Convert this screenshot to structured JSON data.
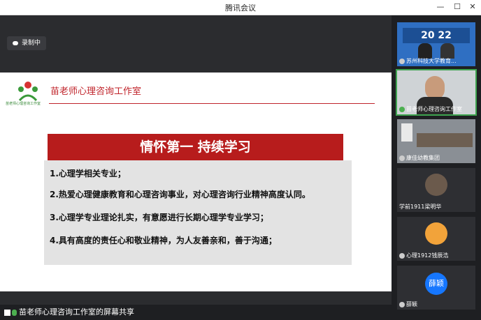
{
  "window": {
    "title": "腾讯会议"
  },
  "recording": {
    "label": "录制中"
  },
  "slide": {
    "logo_text": "苗老师心理咨询工作室",
    "studio_name": "苗老师心理咨询工作室",
    "banner": "情怀第一 持续学习",
    "items": [
      "1.心理学相关专业；",
      "2.热爱心理健康教育和心理咨询事业，对心理咨询行业精神高度认同。",
      "3.心理学专业理论扎实，有意愿进行长期心理学专业学习；",
      "4.具有高度的责任心和敬业精神，为人友善亲和，善于沟通；"
    ]
  },
  "share_bar": {
    "label": "苗老师心理咨询工作室的屏幕共享"
  },
  "participants": [
    {
      "name": "苏州科技大学教育..."
    },
    {
      "name": "苗老师心理咨询工作室"
    },
    {
      "name": "康佳幼教集团"
    },
    {
      "name": "学前1911梁明华"
    },
    {
      "name": "心理1912钱辰浩"
    },
    {
      "name": "薛颖",
      "avatar": "薛颖"
    }
  ],
  "colors": {
    "accent_red": "#b71c1c",
    "active_green": "#3ea34f",
    "avatar_blue": "#1677ff"
  }
}
